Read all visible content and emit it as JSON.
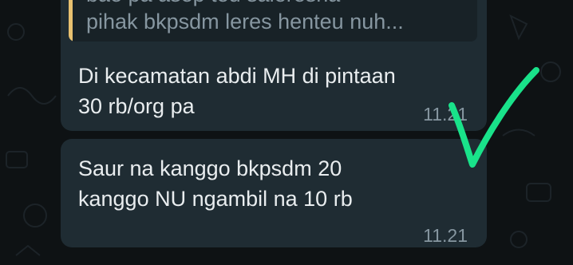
{
  "chat": {
    "messages": [
      {
        "quote": {
          "line1": "bae pa asep teu saleresna",
          "line2": "pihak bkpsdm leres henteu nuh...",
          "accent_color": "#e8c170"
        },
        "line1": "Di kecamatan abdi MH di pintaan",
        "line2": "30 rb/org pa",
        "time": "11.21"
      },
      {
        "line1": "Saur na kanggo bkpsdm 20",
        "line2": "kanggo NU ngambil na 10 rb",
        "time": "11.21"
      }
    ]
  },
  "annotation": {
    "icon": "checkmark-icon",
    "color": "#19e28a"
  },
  "theme": {
    "background": "#0e1214",
    "bubble": "#1f2c33",
    "text": "#e9edef",
    "meta": "#8696a0"
  }
}
